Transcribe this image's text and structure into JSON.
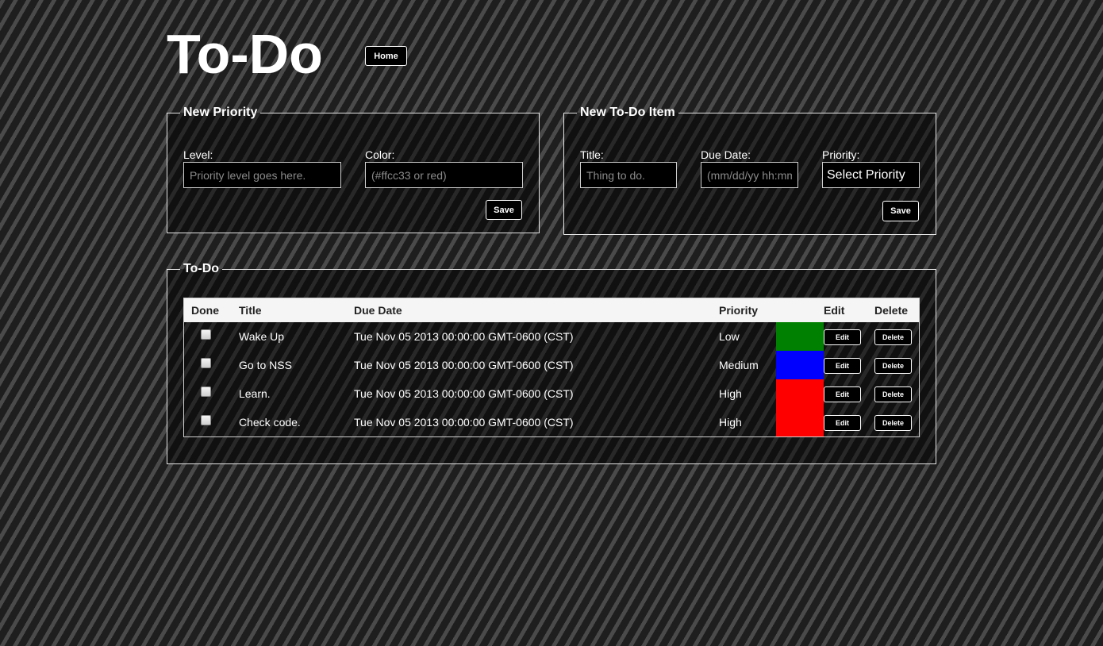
{
  "header": {
    "title": "To-Do",
    "home_label": "Home"
  },
  "new_priority": {
    "legend": "New Priority",
    "level_label": "Level:",
    "level_placeholder": "Priority level goes here.",
    "color_label": "Color:",
    "color_placeholder": "(#ffcc33 or red)",
    "save_label": "Save"
  },
  "new_todo": {
    "legend": "New To-Do Item",
    "title_label": "Title:",
    "title_placeholder": "Thing to do.",
    "due_label": "Due Date:",
    "due_placeholder": "(mm/dd/yy hh:mm)",
    "priority_label": "Priority:",
    "priority_selected": "Select Priority",
    "save_label": "Save"
  },
  "todo_list": {
    "legend": "To-Do",
    "columns": {
      "done": "Done",
      "title": "Title",
      "due": "Due Date",
      "priority": "Priority",
      "color": "",
      "edit": "Edit",
      "delete": "Delete"
    },
    "rows": [
      {
        "done": false,
        "title": "Wake Up",
        "due": "Tue Nov 05 2013 00:00:00 GMT-0600 (CST)",
        "priority": "Low",
        "color": "#008000",
        "edit_label": "Edit",
        "delete_label": "Delete"
      },
      {
        "done": false,
        "title": "Go to NSS",
        "due": "Tue Nov 05 2013 00:00:00 GMT-0600 (CST)",
        "priority": "Medium",
        "color": "#0000ff",
        "edit_label": "Edit",
        "delete_label": "Delete"
      },
      {
        "done": false,
        "title": "Learn.",
        "due": "Tue Nov 05 2013 00:00:00 GMT-0600 (CST)",
        "priority": "High",
        "color": "#ff0000",
        "edit_label": "Edit",
        "delete_label": "Delete"
      },
      {
        "done": false,
        "title": "Check code.",
        "due": "Tue Nov 05 2013 00:00:00 GMT-0600 (CST)",
        "priority": "High",
        "color": "#ff0000",
        "edit_label": "Edit",
        "delete_label": "Delete"
      }
    ]
  }
}
